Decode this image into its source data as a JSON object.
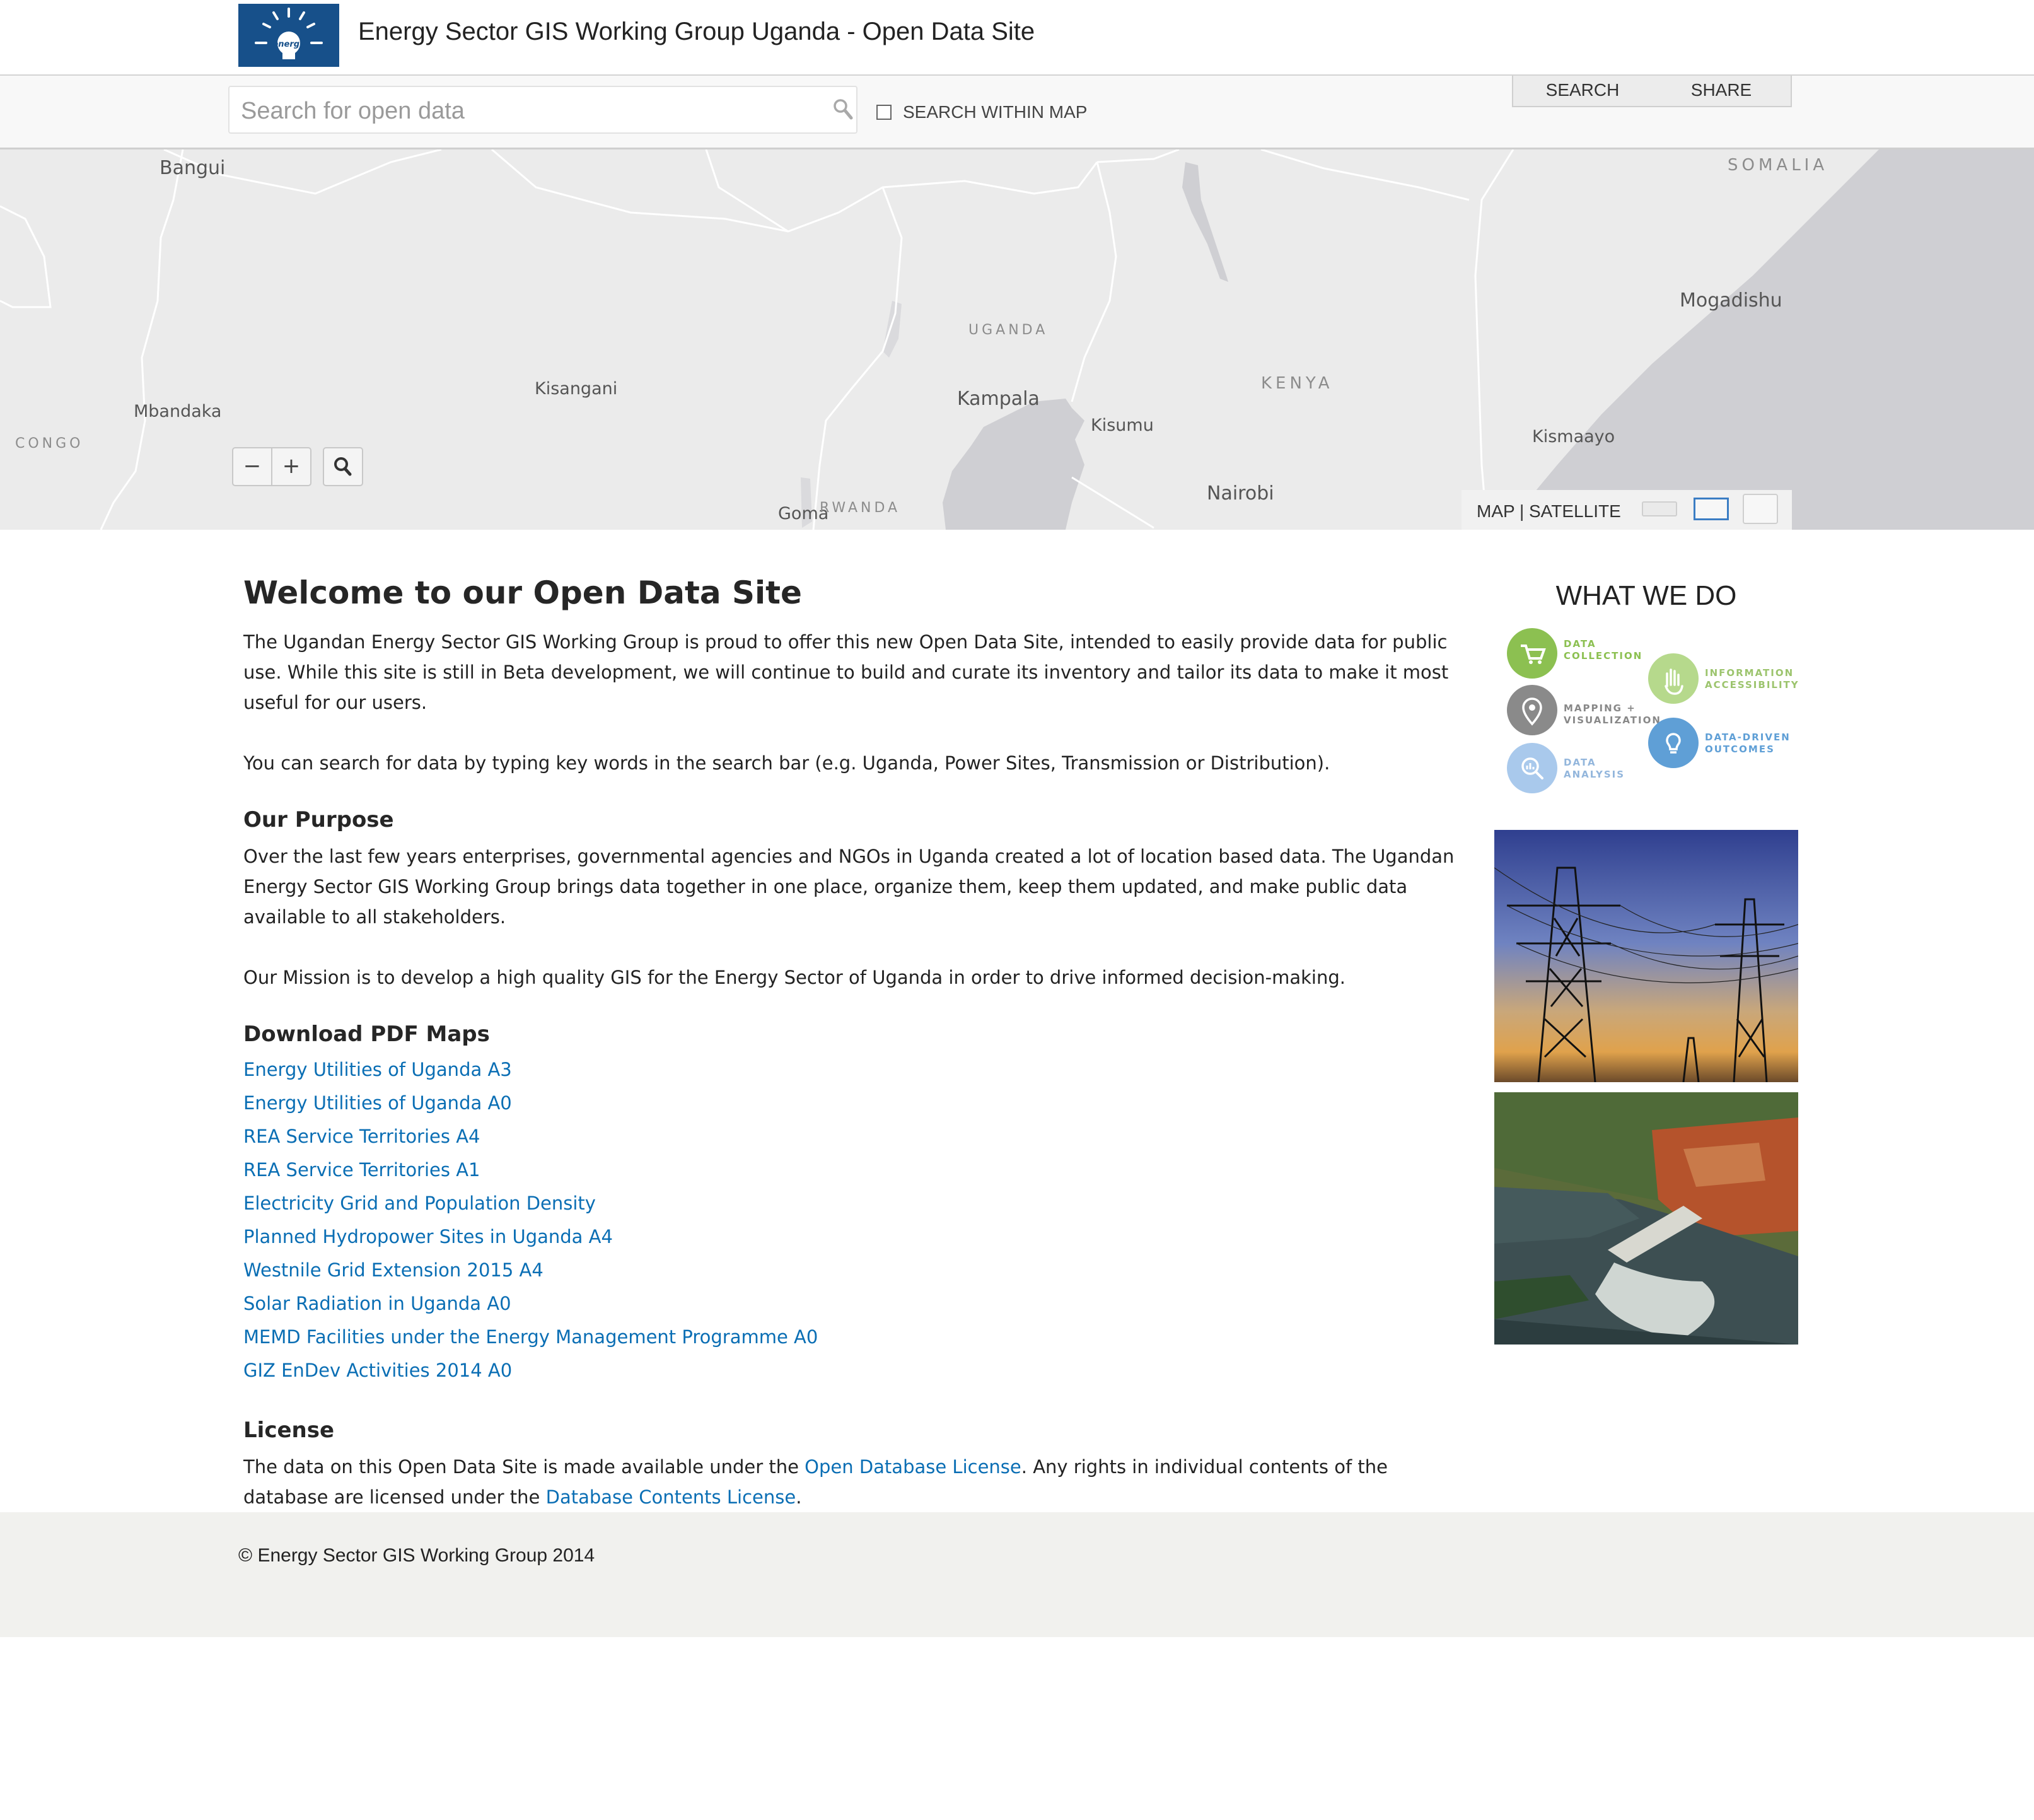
{
  "header": {
    "title": "Energy Sector GIS Working Group Uganda - Open Data Site",
    "logo_text": "energy"
  },
  "toolbar": {
    "search_placeholder": "Search for open data",
    "search_value": "",
    "within_map_label": "SEARCH WITHIN MAP",
    "within_map_checked": false,
    "tabs": [
      {
        "label": "SEARCH"
      },
      {
        "label": "SHARE"
      }
    ]
  },
  "map": {
    "labels": {
      "bangui": "Bangui",
      "somalia": "SOMALIA",
      "mogadishu": "Mogadishu",
      "uganda": "UGANDA",
      "kisangani": "Kisangani",
      "mbandaka": "Mbandaka",
      "kampala": "Kampala",
      "kenya": "KENYA",
      "kisumu": "Kisumu",
      "kismaayo": "Kismaayo",
      "congo": "CONGO",
      "nairobi": "Nairobi",
      "goma": "Goma",
      "rwanda": "RWANDA"
    },
    "zoom_out_label": "−",
    "zoom_in_label": "+",
    "basemap_toggle": "MAP | SATELLITE"
  },
  "content": {
    "welcome_title": "Welcome to our Open Data Site",
    "intro": "The Ugandan Energy Sector GIS Working Group is proud to offer this new Open Data Site, intended to easily provide data for public use. While this site is still in Beta development, we will continue to build and curate its inventory and tailor its data to make it most useful for our users.",
    "search_hint": "You can search for data by typing key words in the search bar (e.g. Uganda, Power Sites, Transmission or Distribution).",
    "purpose_heading": "Our Purpose",
    "purpose_text": "Over the last few years enterprises, governmental agencies and NGOs in Uganda created a lot of location based data. The Ugandan Energy Sector GIS Working Group brings data together in one place, organize them, keep them updated, and make public data available to all stakeholders.",
    "mission_text": "Our Mission is to develop a high quality GIS for the Energy Sector of Uganda in order to drive informed decision-making.",
    "pdf_heading": "Download PDF Maps",
    "pdf_links": [
      "Energy Utilities of Uganda A3",
      "Energy Utilities of Uganda A0",
      "REA Service Territories A4",
      "REA Service Territories A1",
      "Electricity Grid and Population Density",
      "Planned Hydropower Sites in Uganda A4",
      "Westnile Grid Extension 2015 A4",
      "Solar Radiation in Uganda A0",
      "MEMD Facilities under the Energy Management Programme A0",
      "GIZ EnDev Activities 2014 A0"
    ],
    "license_heading": "License",
    "license_text_1": "The data on this Open Data Site is made available under the ",
    "license_link_1": "Open Database License",
    "license_text_2": ". Any rights in individual contents of the database are licensed under the ",
    "license_link_2": "Database Contents License",
    "license_text_3": "."
  },
  "sidebar": {
    "what_we_do_title": "WHAT WE DO",
    "items": [
      {
        "label_1": "DATA",
        "label_2": "COLLECTION",
        "color": "#8cc051",
        "icon": "cart-icon"
      },
      {
        "label_1": "INFORMATION",
        "label_2": "ACCESSIBILITY",
        "color": "#b6d98c",
        "icon": "hand-icon"
      },
      {
        "label_1": "MAPPING +",
        "label_2": "VISUALIZATION",
        "color": "#8a8a8a",
        "icon": "map-pin-icon"
      },
      {
        "label_1": "DATA-DRIVEN",
        "label_2": "OUTCOMES",
        "color": "#5f9fd6",
        "icon": "lightbulb-icon"
      },
      {
        "label_1": "DATA",
        "label_2": "ANALYSIS",
        "color": "#a9c9ec",
        "icon": "analysis-icon"
      }
    ]
  },
  "footer": {
    "copyright": "© Energy Sector GIS Working Group 2014"
  },
  "colors": {
    "brand_blue": "#17508a",
    "link": "#0a6eb4",
    "map_land": "#ebebeb",
    "map_water": "#cfcfd3",
    "footer_bg": "#f1f1ee"
  }
}
